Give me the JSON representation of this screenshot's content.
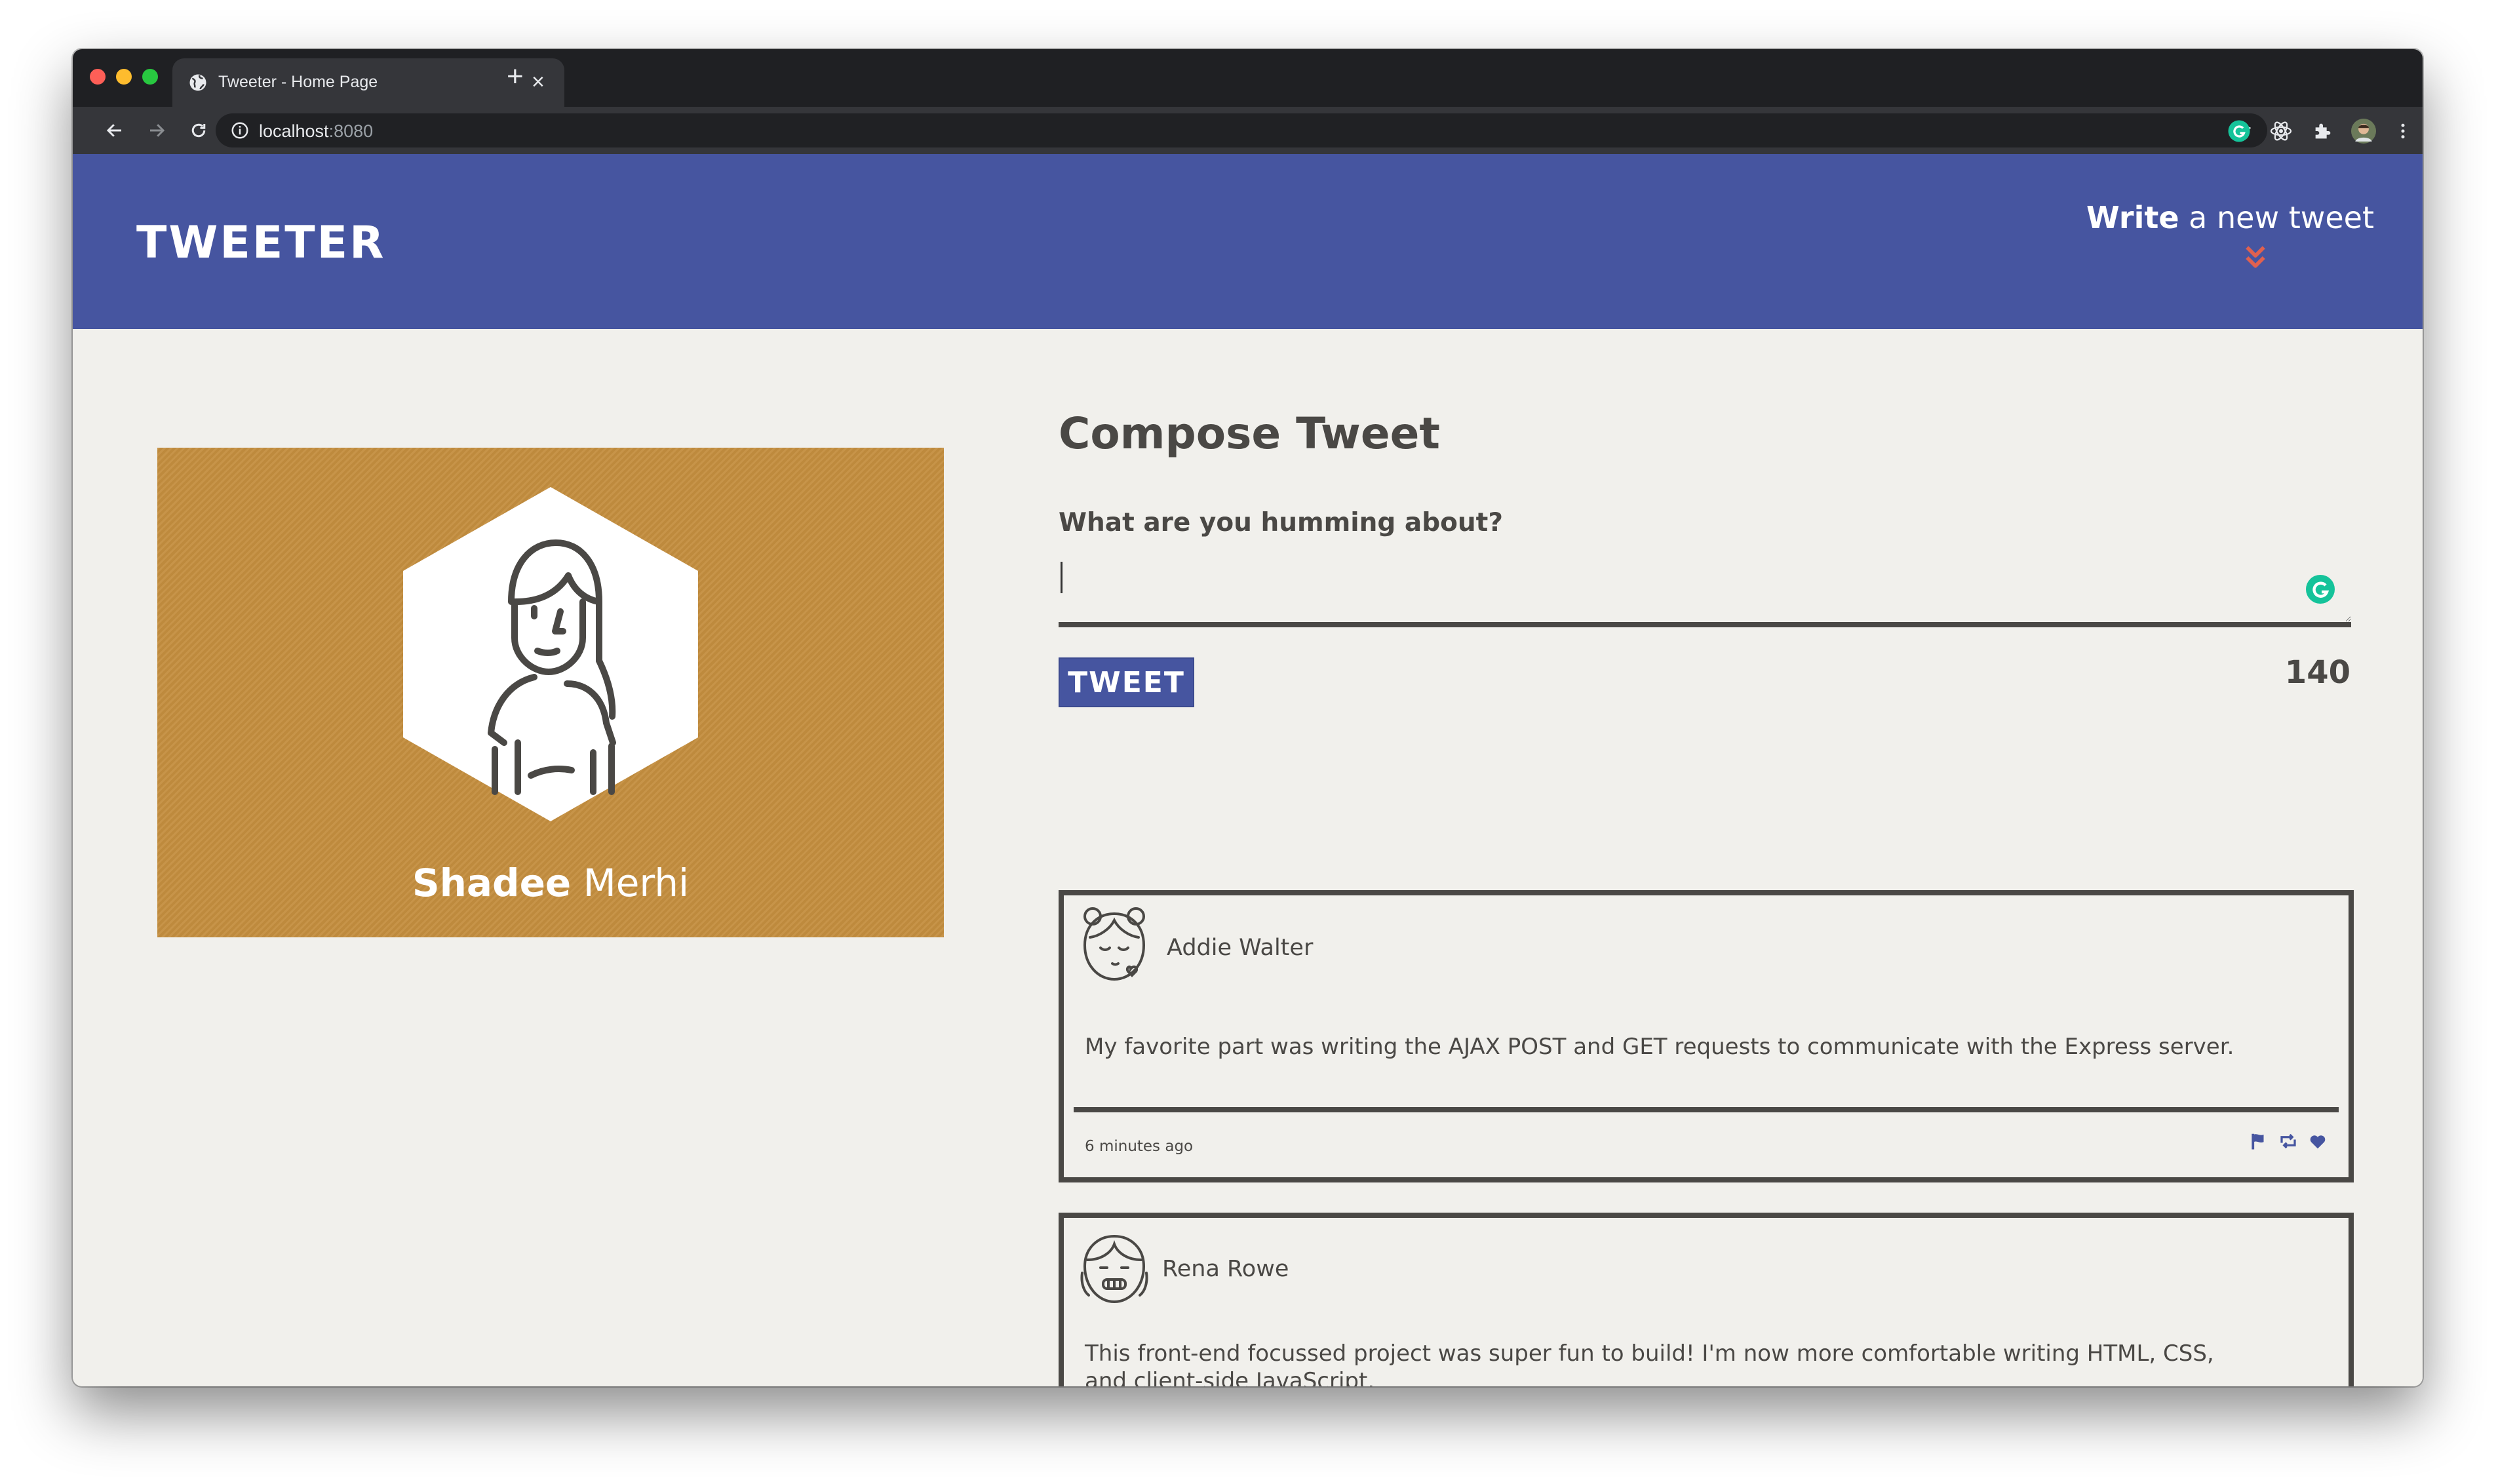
{
  "browser": {
    "tab_title": "Tweeter - Home Page",
    "tab_close": "×",
    "new_tab": "+",
    "url_host": "localhost",
    "url_port": ":8080"
  },
  "header": {
    "logo": "TWEETER",
    "write_bold": "Write",
    "write_rest": " a new tweet"
  },
  "profile": {
    "first_name": "Shadee",
    "last_name": " Merhi"
  },
  "compose": {
    "title": "Compose Tweet",
    "label": "What are you humming about?",
    "input_value": "",
    "button_label": "TWEET",
    "counter": "140"
  },
  "tweets": [
    {
      "name": "Addie Walter",
      "text": "My favorite part was writing the AJAX POST and GET requests to communicate with the Express server.",
      "time": "6 minutes ago"
    },
    {
      "name": "Rena Rowe",
      "text": "This front-end focussed project was super fun to build! I'm now more comfortable writing HTML, CSS, and client-side JavaScript.",
      "time": ""
    }
  ],
  "colors": {
    "header_bg": "#4655a0",
    "page_bg": "#f1f0ec",
    "profile_bg": "#c48e3f",
    "text": "#4a4845",
    "accent": "#e0614f"
  },
  "icons": [
    "globe-icon",
    "back-icon",
    "forward-icon",
    "reload-icon",
    "info-icon",
    "star-icon",
    "grammarly-extension-icon",
    "react-devtools-icon",
    "puzzle-icon",
    "profile-avatar-icon",
    "kebab-menu-icon",
    "chevrons-down-icon",
    "flag-icon",
    "retweet-icon",
    "heart-icon"
  ]
}
